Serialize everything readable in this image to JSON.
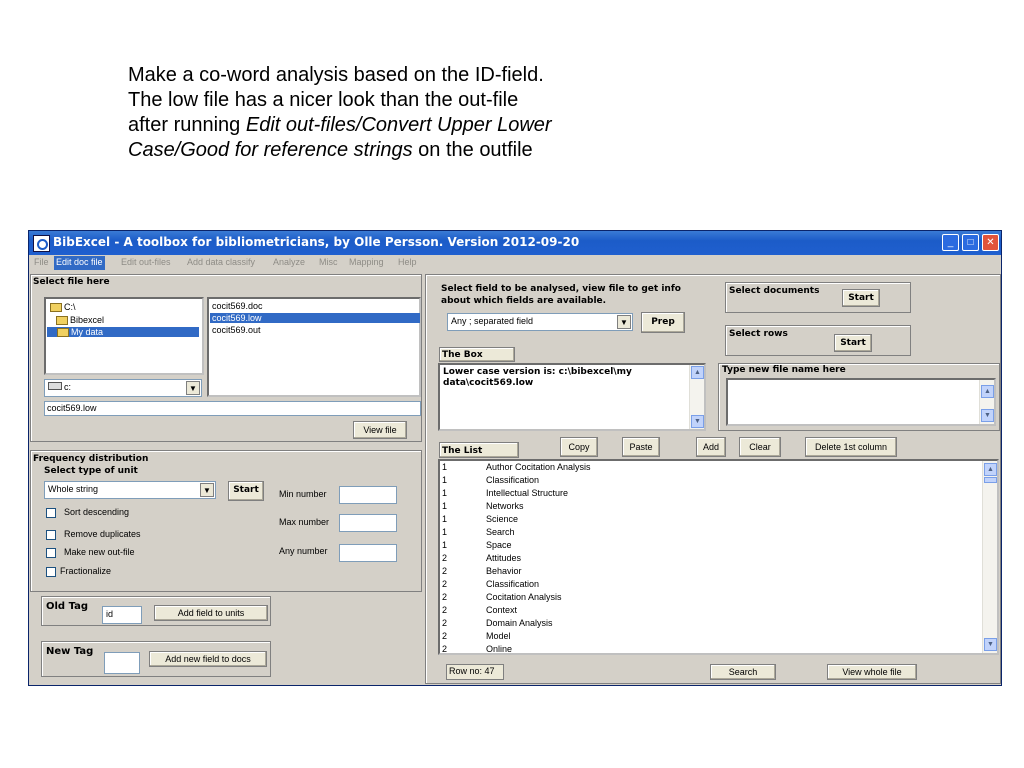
{
  "caption": {
    "line1": "Make a co-word analysis based on the ID-field.",
    "line2": "The low file has a nicer look than the out-file",
    "line3_plain": "after running ",
    "line3_italic": "Edit out-files/Convert Upper Lower",
    "line4_italic": "Case/Good for reference strings",
    "line4_plain": " on the outfile"
  },
  "window": {
    "title": "BibExcel - A toolbox for bibliometricians, by Olle Persson. Version 2012-09-20",
    "controls": {
      "minimize": "_",
      "maximize": "□",
      "close": "✕"
    }
  },
  "menu": [
    "File",
    "Edit doc file",
    "Edit out-files",
    "Add data classify",
    "Analyze",
    "Misc",
    "Mapping",
    "Help"
  ],
  "menu_selected": "Edit doc file",
  "file_panel": {
    "heading": "Select file here",
    "tree": [
      "C:\\",
      "Bibexcel",
      "My data"
    ],
    "selected_folder": "My data",
    "files": [
      "cocit569.doc",
      "cocit569.low",
      "cocit569.out"
    ],
    "selected_file": "cocit569.low",
    "drive": "c:",
    "path_value": "cocit569.low",
    "view_file_button": "View file"
  },
  "freq_panel": {
    "heading": "Frequency distribution",
    "unit_label": "Select type of unit",
    "unit_value": "Whole string",
    "start_button": "Start",
    "options": [
      "Sort descending",
      "Remove duplicates",
      "Make new out-file",
      "Fractionalize"
    ],
    "min_label": "Min number",
    "max_label": "Max number",
    "any_label": "Any number"
  },
  "old_tag": {
    "label": "Old Tag",
    "value": "id",
    "button": "Add field to units"
  },
  "new_tag": {
    "label": "New Tag",
    "value": "",
    "button": "Add new field to docs"
  },
  "analyse": {
    "text1": "Select field to be analysed, view file to get info",
    "text2": "about which fields are available.",
    "field_value": "Any ; separated field",
    "prep_button": "Prep"
  },
  "select_documents": {
    "label": "Select documents",
    "button": "Start"
  },
  "select_rows": {
    "label": "Select rows",
    "button": "Start"
  },
  "the_box": {
    "label": "The Box",
    "line1": "Lower case version is: c:\\bibexcel\\my",
    "line2": "data\\cocit569.low"
  },
  "new_file": {
    "label": "Type new file name here",
    "value": ""
  },
  "the_list": {
    "label": "The List",
    "buttons": {
      "copy": "Copy",
      "paste": "Paste",
      "add": "Add",
      "clear": "Clear",
      "delete_first": "Delete 1st column"
    },
    "rows": [
      {
        "n": "1",
        "t": "Author Cocitation Analysis"
      },
      {
        "n": "1",
        "t": "Classification"
      },
      {
        "n": "1",
        "t": "Intellectual Structure"
      },
      {
        "n": "1",
        "t": "Networks"
      },
      {
        "n": "1",
        "t": "Science"
      },
      {
        "n": "1",
        "t": "Search"
      },
      {
        "n": "1",
        "t": "Space"
      },
      {
        "n": "2",
        "t": "Attitudes"
      },
      {
        "n": "2",
        "t": "Behavior"
      },
      {
        "n": "2",
        "t": "Classification"
      },
      {
        "n": "2",
        "t": "Cocitation Analysis"
      },
      {
        "n": "2",
        "t": "Context"
      },
      {
        "n": "2",
        "t": "Domain Analysis"
      },
      {
        "n": "2",
        "t": "Model"
      },
      {
        "n": "2",
        "t": "Online"
      }
    ]
  },
  "footer": {
    "row_no": "Row no: 47",
    "search_button": "Search",
    "view_whole_button": "View whole file"
  }
}
